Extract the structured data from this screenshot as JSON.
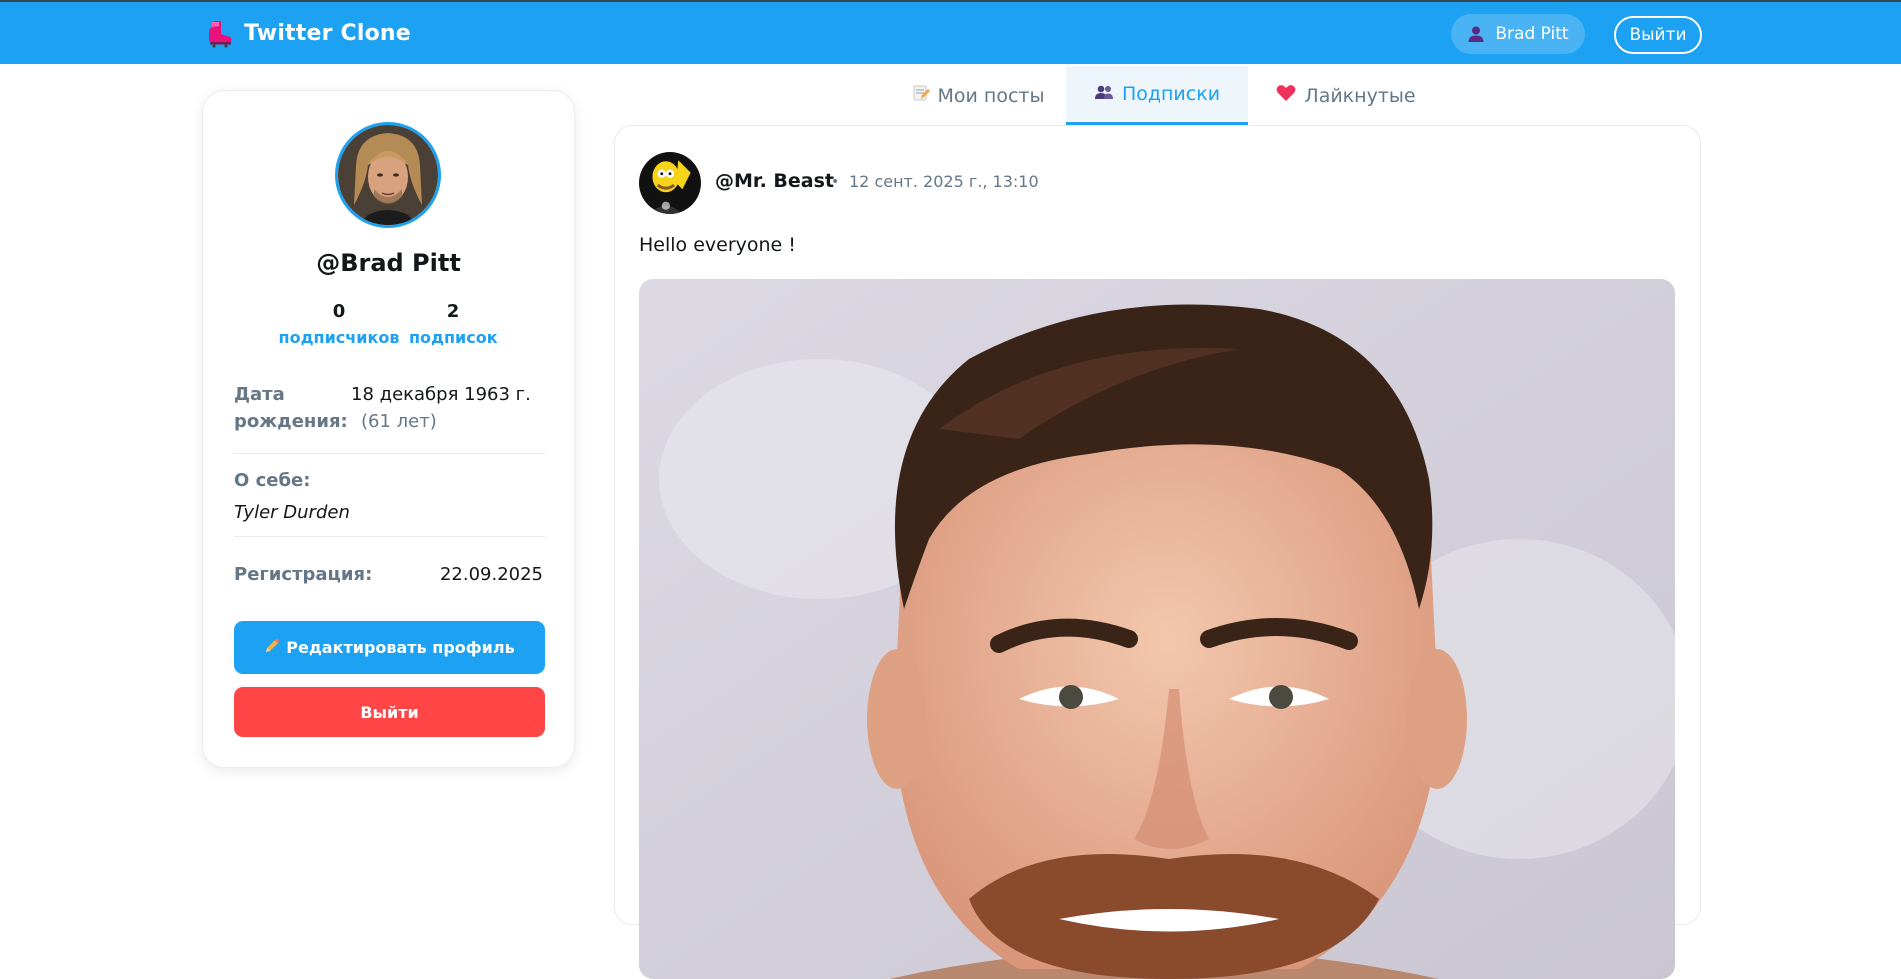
{
  "header": {
    "app_title": "Twitter Clone",
    "logo_icon": "boot-logo-icon",
    "user_name": "Brad Pitt",
    "logout_label": "Выйти",
    "colors": {
      "bar": "#1da1f2",
      "text": "#ffffff"
    }
  },
  "profile": {
    "username": "@Brad Pitt",
    "followers_count": "0",
    "followers_label": "подписчиков",
    "following_count": "2",
    "following_label": "подписок",
    "birth_label": "Дата рождения:",
    "birth_value": "18 декабря 1963 г.",
    "birth_age": "(61 лет)",
    "about_label": "О себе:",
    "about_value": "Tyler Durden",
    "registration_label": "Регистрация:",
    "registration_value": "22.09.2025",
    "edit_button_label": "Редактировать профиль",
    "logout_button_label": "Выйти",
    "colors": {
      "accent": "#1da1f2",
      "danger": "#ff4545"
    }
  },
  "tabs": [
    {
      "label": "Мои посты",
      "icon": "memo-icon",
      "active": false
    },
    {
      "label": "Подписки",
      "icon": "people-icon",
      "active": true
    },
    {
      "label": "Лайкнутые",
      "icon": "heart-icon",
      "active": false
    }
  ],
  "post": {
    "author": "@Mr. Beast",
    "separator": "•",
    "date": "12 сент. 2025 г., 13:10",
    "text": "Hello everyone !"
  }
}
